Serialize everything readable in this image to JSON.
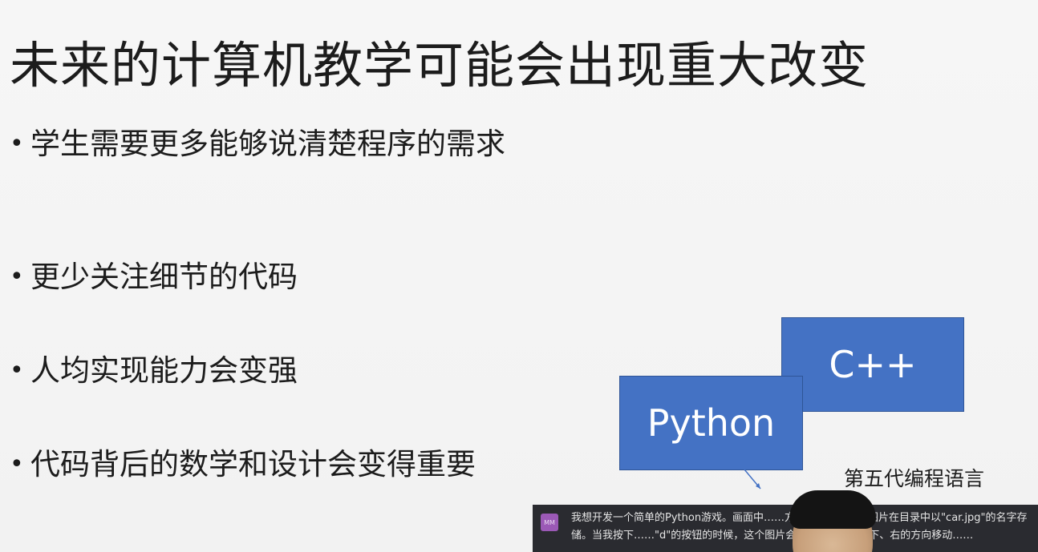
{
  "slide": {
    "title": "未来的计算机教学可能会出现重大改变",
    "bullet_symbol": "•",
    "bullets": [
      "学生需要更多能够说清楚程序的需求",
      "更少关注细节的代码",
      "人均实现能力会变强",
      "代码背后的数学和设计会变得重要"
    ],
    "diagram": {
      "box_cpp": "C++",
      "box_python": "Python",
      "label": "第五代编程语言",
      "box_color": "#4472c4"
    }
  },
  "chat": {
    "avatar_initials": "MM",
    "avatar_color": "#9b59b6",
    "message": "我想开发一个简单的Python游戏。画面中……方形的图片，这个图片在目录中以\"car.jpg\"的名字存储。当我按下……\"d\"的按钮的时候，这个图片会分别向上、左、下、右的方向移动……"
  }
}
